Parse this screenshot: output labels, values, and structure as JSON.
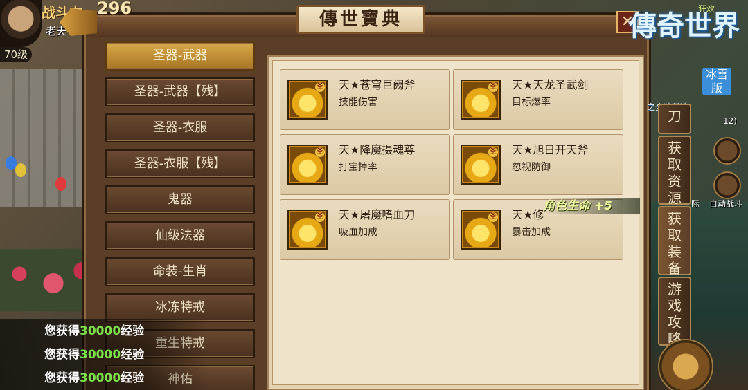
{
  "hud": {
    "power_label": "战斗力",
    "power_value": "296",
    "player_name": "老夫",
    "level": "70级"
  },
  "panel": {
    "title": "傳世寶典",
    "close_symbol": "✕"
  },
  "categories": [
    {
      "label": "圣器-武器",
      "active": true
    },
    {
      "label": "圣器-武器【残】",
      "active": false
    },
    {
      "label": "圣器-衣服",
      "active": false
    },
    {
      "label": "圣器-衣服【残】",
      "active": false
    },
    {
      "label": "鬼器",
      "active": false
    },
    {
      "label": "仙级法器",
      "active": false
    },
    {
      "label": "命装-生肖",
      "active": false
    },
    {
      "label": "冰冻特戒",
      "active": false
    },
    {
      "label": "重生特戒",
      "active": false
    },
    {
      "label": "神佑",
      "active": false
    }
  ],
  "items": [
    {
      "name": "天★苍穹巨阙斧",
      "effect": "技能伤害",
      "icon": "axe-icon"
    },
    {
      "name": "天★天龙圣武剑",
      "effect": "目标爆率",
      "icon": "sword-icon"
    },
    {
      "name": "天★降魔摄魂尊",
      "effect": "打宝掉率",
      "icon": "relic-icon"
    },
    {
      "name": "天★旭日开天斧",
      "effect": "忽视防御",
      "icon": "axe-icon"
    },
    {
      "name": "天★屠魔嗜血刀",
      "effect": "吸血加成",
      "icon": "blade-icon"
    },
    {
      "name": "天★修",
      "effect": "暴击加成",
      "icon": "blade-icon"
    }
  ],
  "item_badge": "圣",
  "side_tabs": [
    {
      "label": "刀",
      "active": false
    },
    {
      "label": "获取资源",
      "active": false
    },
    {
      "label": "获取装备",
      "active": true
    },
    {
      "label": "游戏攻略",
      "active": false
    }
  ],
  "logo": {
    "main": "傳奇世界",
    "badge": "冰雪版",
    "subtitle": "之全装载决"
  },
  "top_right_text": "狂欢",
  "buff": {
    "text": "角色生命",
    "value": "+5"
  },
  "hud_right": {
    "auto_fight": "自动战斗",
    "counter": "12)",
    "side_label": "际"
  },
  "chat": [
    {
      "prefix": "您获得",
      "amount": "30000",
      "suffix": "经验"
    },
    {
      "prefix": "您获得",
      "amount": "30000",
      "suffix": "经验"
    },
    {
      "prefix": "您获得",
      "amount": "30000",
      "suffix": "经验"
    }
  ]
}
